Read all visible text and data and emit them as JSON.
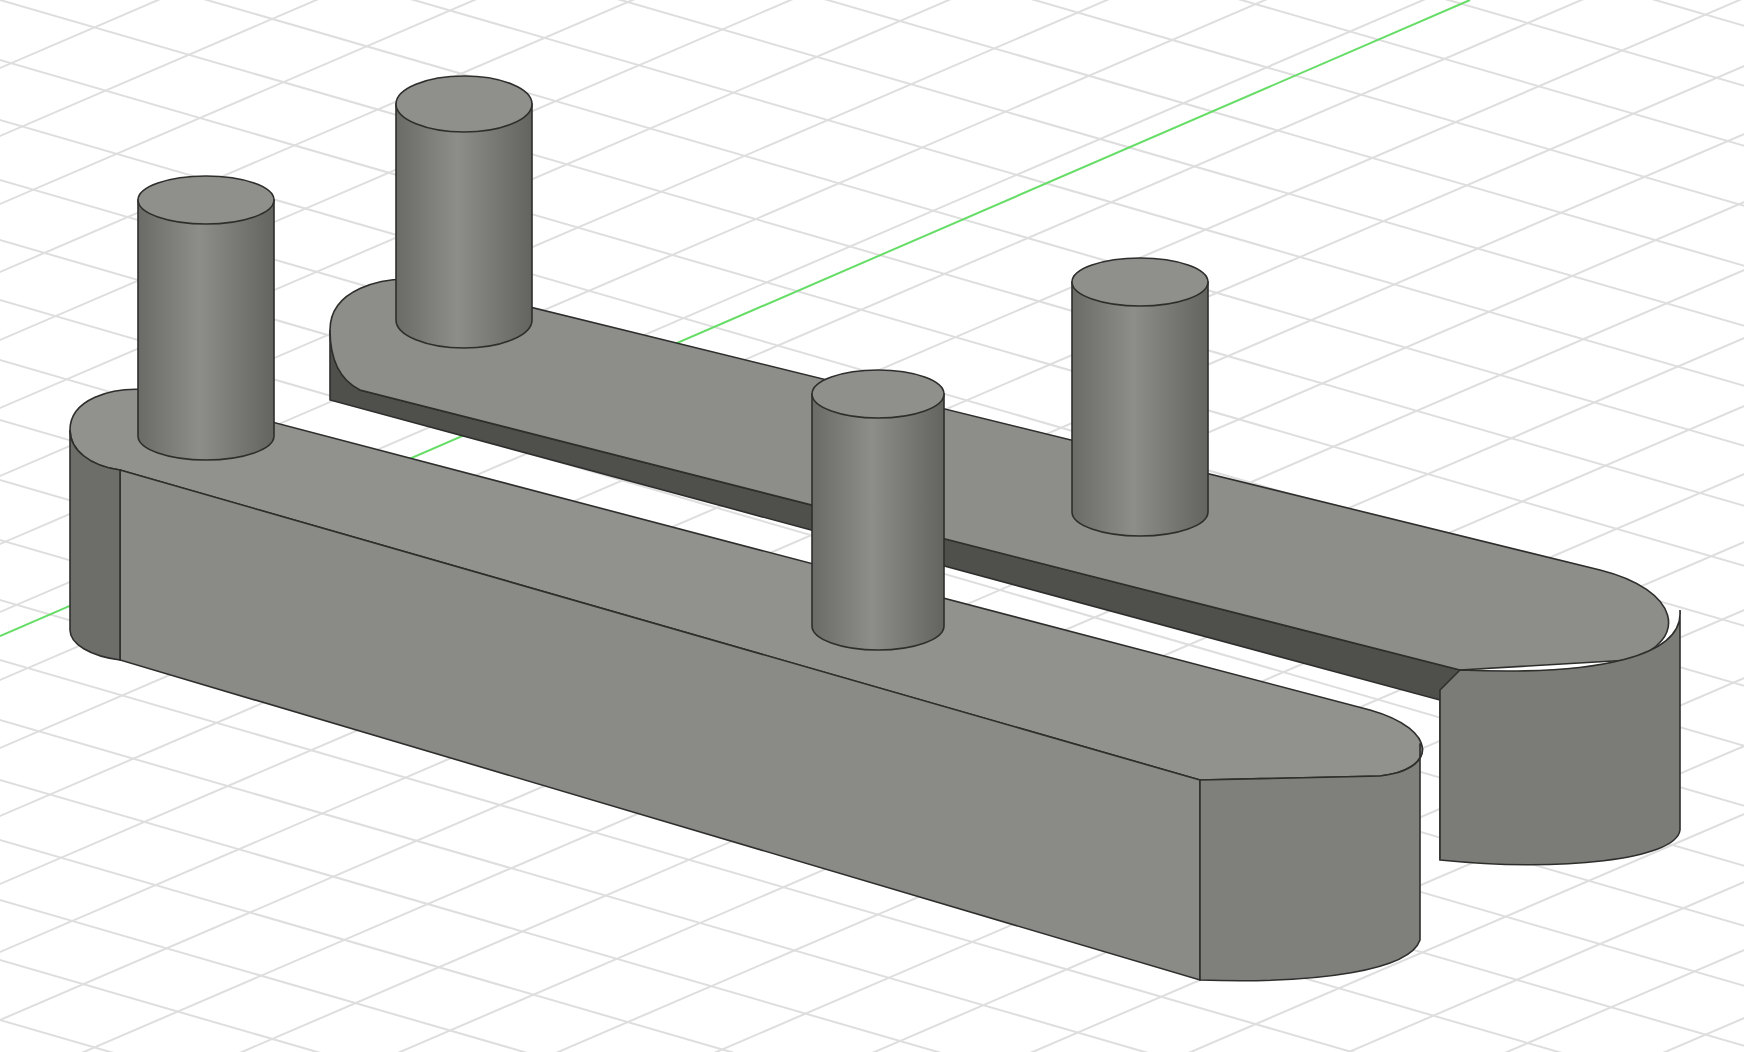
{
  "viewport": {
    "show_grid": true,
    "show_axis": true
  }
}
